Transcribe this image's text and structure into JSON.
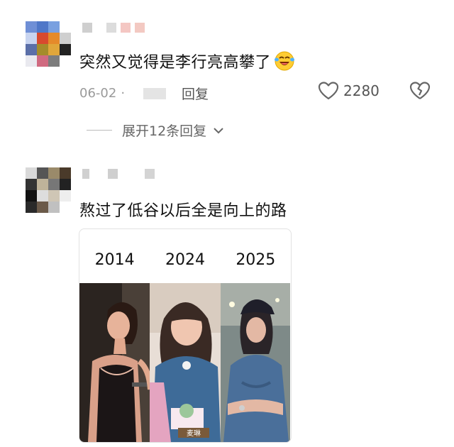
{
  "comments": [
    {
      "text": "突然又觉得是李行亮高攀了",
      "emoji": "laughing-crying-emoji",
      "date": "06-02",
      "separator": "·",
      "reply_label": "回复",
      "like_count": "2280",
      "expand_label": "展开12条回复"
    },
    {
      "text": "熬过了低谷以后全是向上的路",
      "image": {
        "years": [
          "2014",
          "2024",
          "2025"
        ],
        "caption": "麦琳"
      }
    }
  ],
  "colors": {
    "meta_gray": "#9a9a9a",
    "text": "#111111"
  }
}
